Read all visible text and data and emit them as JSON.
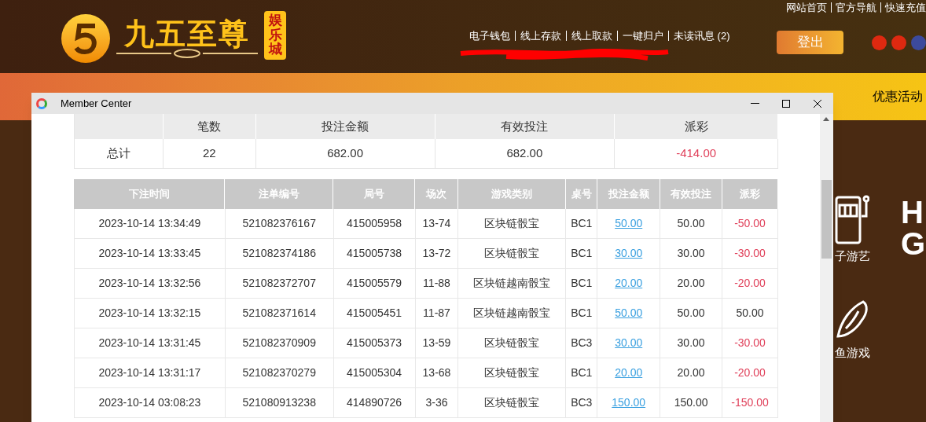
{
  "site": {
    "logo_text": "九五至尊",
    "logo_badge": "娱乐城",
    "top_links": [
      "网站首页",
      "官方导航",
      "快速充值"
    ],
    "account_links": [
      "电子钱包",
      "线上存款",
      "线上取款",
      "一键归户",
      "未读讯息 (2)"
    ],
    "logout_button": "登出",
    "nav_items": [
      "优惠活动"
    ],
    "side_items": [
      {
        "kind": "slot",
        "label": "子游艺"
      },
      {
        "kind": "shell",
        "label": "鱼游戏"
      }
    ],
    "side_banner": [
      "H",
      "G"
    ]
  },
  "window": {
    "title": "Member Center",
    "summary": {
      "columns": [
        "",
        "笔数",
        "投注金额",
        "有效投注",
        "派彩"
      ],
      "row": [
        {
          "text": "总计",
          "negative": false
        },
        {
          "text": "22",
          "negative": false
        },
        {
          "text": "682.00",
          "negative": false
        },
        {
          "text": "682.00",
          "negative": false
        },
        {
          "text": "-414.00",
          "negative": true
        }
      ]
    },
    "table": {
      "columns": [
        "下注时间",
        "注单编号",
        "局号",
        "场次",
        "游戏类别",
        "桌号",
        "投注金额",
        "有效投注",
        "派彩"
      ],
      "rows": [
        {
          "time": "2023-10-14 13:34:49",
          "ticket": "521082376167",
          "round": "415005958",
          "session": "13-74",
          "game": "区块链骰宝",
          "table": "BC1",
          "bet": "50.00",
          "valid": "50.00",
          "payout": "-50.00",
          "negative": true
        },
        {
          "time": "2023-10-14 13:33:45",
          "ticket": "521082374186",
          "round": "415005738",
          "session": "13-72",
          "game": "区块链骰宝",
          "table": "BC1",
          "bet": "30.00",
          "valid": "30.00",
          "payout": "-30.00",
          "negative": true
        },
        {
          "time": "2023-10-14 13:32:56",
          "ticket": "521082372707",
          "round": "415005579",
          "session": "11-88",
          "game": "区块链越南骰宝",
          "table": "BC1",
          "bet": "20.00",
          "valid": "20.00",
          "payout": "-20.00",
          "negative": true
        },
        {
          "time": "2023-10-14 13:32:15",
          "ticket": "521082371614",
          "round": "415005451",
          "session": "11-87",
          "game": "区块链越南骰宝",
          "table": "BC1",
          "bet": "50.00",
          "valid": "50.00",
          "payout": "50.00",
          "negative": false
        },
        {
          "time": "2023-10-14 13:31:45",
          "ticket": "521082370909",
          "round": "415005373",
          "session": "13-59",
          "game": "区块链骰宝",
          "table": "BC3",
          "bet": "30.00",
          "valid": "30.00",
          "payout": "-30.00",
          "negative": true
        },
        {
          "time": "2023-10-14 13:31:17",
          "ticket": "521082370279",
          "round": "415005304",
          "session": "13-68",
          "game": "区块链骰宝",
          "table": "BC1",
          "bet": "20.00",
          "valid": "20.00",
          "payout": "-20.00",
          "negative": true
        },
        {
          "time": "2023-10-14 03:08:23",
          "ticket": "521080913238",
          "round": "414890726",
          "session": "3-36",
          "game": "区块链骰宝",
          "table": "BC3",
          "bet": "150.00",
          "valid": "150.00",
          "payout": "-150.00",
          "negative": true
        }
      ]
    }
  }
}
